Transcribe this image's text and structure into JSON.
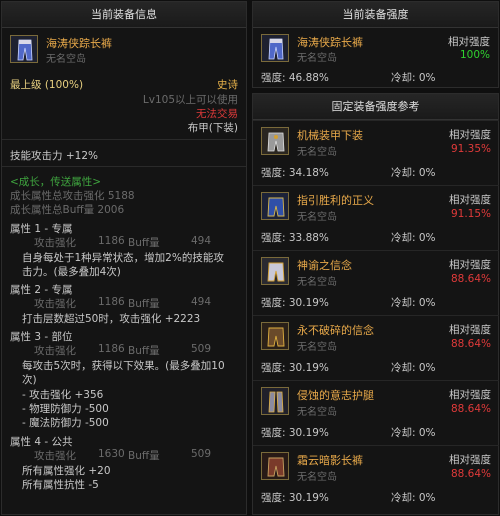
{
  "left": {
    "title": "当前装备信息",
    "item": {
      "name": "海涛侠踪长裤",
      "sub": "无名空岛",
      "icon": "trousers-icon"
    },
    "grade": "最上级 (100%)",
    "rarity": "史诗",
    "level_req": "Lv105以上可以使用",
    "trade": "无法交易",
    "armor_type": "布甲(下装)",
    "skill_attack": "技能攻击力  +12%",
    "growth": {
      "header": "<成长，传送属性>",
      "total_attack": "成长属性总攻击强化 5188",
      "total_buff": "成长属性总Buff量 2006"
    },
    "attributes": [
      {
        "title": "属性 1 - 专属",
        "attack_label": "攻击强化",
        "attack": "1186",
        "buff_label": "Buff量",
        "buff": "494",
        "desc": [
          "自身每处于1种异常状态，增加2%的技能攻",
          "击力。(最多叠加4次)"
        ]
      },
      {
        "title": "属性 2 - 专属",
        "attack_label": "攻击强化",
        "attack": "1186",
        "buff_label": "Buff量",
        "buff": "494",
        "desc": [
          "打击层数超过50时，攻击强化 +2223"
        ]
      },
      {
        "title": "属性 3 - 部位",
        "attack_label": "攻击强化",
        "attack": "1186",
        "buff_label": "Buff量",
        "buff": "509",
        "desc": [
          "每攻击5次时，获得以下效果。(最多叠加10",
          "次)",
          "- 攻击强化 +356",
          "- 物理防御力 -500",
          "- 魔法防御力 -500"
        ]
      },
      {
        "title": "属性 4 - 公共",
        "attack_label": "攻击强化",
        "attack": "1630",
        "buff_label": "Buff量",
        "buff": "509",
        "desc": [
          "所有属性强化 +20",
          "所有属性抗性 -5"
        ]
      }
    ]
  },
  "right_top": {
    "title": "当前装备强度",
    "item": {
      "name": "海涛侠踪长裤",
      "sub": "无名空岛",
      "icon": "trousers-icon"
    },
    "rel_label": "相对强度",
    "rel_value": "100%",
    "strength": "强度: 46.88%",
    "cooldown": "冷却: 0%"
  },
  "right_ref": {
    "title": "固定装备强度参考",
    "items": [
      {
        "name": "机械装甲下装",
        "sub": "无名空岛",
        "rel_label": "相对强度",
        "rel_value": "91.35%",
        "strength": "强度: 34.18%",
        "cooldown": "冷却: 0%",
        "icon": "mech-armor-icon"
      },
      {
        "name": "指引胜利的正义",
        "sub": "无名空岛",
        "rel_label": "相对强度",
        "rel_value": "91.15%",
        "strength": "强度: 33.88%",
        "cooldown": "冷却: 0%",
        "icon": "justice-pants-icon"
      },
      {
        "name": "神谕之信念",
        "sub": "无名空岛",
        "rel_label": "相对强度",
        "rel_value": "88.64%",
        "strength": "强度: 30.19%",
        "cooldown": "冷却: 0%",
        "icon": "oracle-pants-icon"
      },
      {
        "name": "永不破碎的信念",
        "sub": "无名空岛",
        "rel_label": "相对强度",
        "rel_value": "88.64%",
        "strength": "强度: 30.19%",
        "cooldown": "冷却: 0%",
        "icon": "faith-pants-icon"
      },
      {
        "name": "侵蚀的意志护腿",
        "sub": "无名空岛",
        "rel_label": "相对强度",
        "rel_value": "88.64%",
        "strength": "强度: 30.19%",
        "cooldown": "冷却: 0%",
        "icon": "eroded-greaves-icon"
      },
      {
        "name": "霜云暗影长裤",
        "sub": "无名空岛",
        "rel_label": "相对强度",
        "rel_value": "88.64%",
        "strength": "强度: 30.19%",
        "cooldown": "冷却: 0%",
        "icon": "frost-shadow-pants-icon"
      }
    ]
  }
}
